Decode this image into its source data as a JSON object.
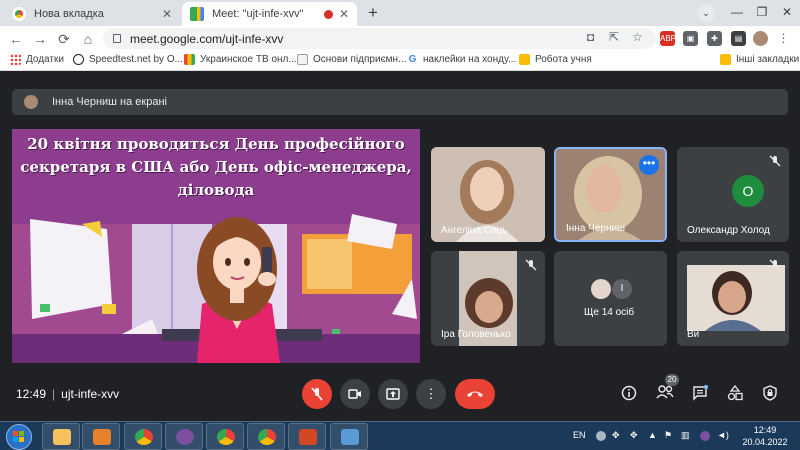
{
  "browser": {
    "tabs": [
      {
        "title": "Нова вкладка",
        "icon": "chrome-icon"
      },
      {
        "title": "Meet: \"ujt-infe-xvv\"",
        "icon": "meet-icon",
        "recording": true
      }
    ],
    "url": "meet.google.com/ujt-infe-xvv",
    "extension_labels": {
      "abp": "ABP"
    },
    "bookmarks": [
      {
        "label": "Додатки",
        "icon": "apps-grid-icon"
      },
      {
        "label": "Speedtest.net by O...",
        "icon": "speedtest-icon"
      },
      {
        "label": "Украинское ТВ онл...",
        "icon": "tv-icon"
      },
      {
        "label": "Основи підприємн...",
        "icon": "doc-icon"
      },
      {
        "label": "наклейки на хонду...",
        "icon": "google-icon"
      },
      {
        "label": "Робота учня",
        "icon": "classroom-icon"
      }
    ],
    "other_bookmarks": "Інші закладки"
  },
  "meet": {
    "presenting_text": "Інна Черниш на екрані",
    "slide_title": "20 квітня проводиться День професійного секретаря в США або День офіс-менеджера, діловода",
    "participants": [
      {
        "name": "Ангеліна Соць"
      },
      {
        "name": "Інна Черниш"
      },
      {
        "name": "Олександр Холод",
        "avatar_letter": "О"
      },
      {
        "name": "Іра Головенько"
      },
      {
        "name": "Ще 14 осіб",
        "avatar_letter": "І"
      },
      {
        "name": "Ви"
      }
    ],
    "time": "12:49",
    "meeting_code": "ujt-infe-xvv",
    "participant_count": "20"
  },
  "taskbar": {
    "language": "EN",
    "time": "12:49",
    "date": "20.04.2022"
  },
  "colors": {
    "meet_bg": "#202124",
    "tile_bg": "#3c4043",
    "hangup_red": "#ea4335",
    "accent_blue": "#1a73e8",
    "slide_purple": "#8c3d8d"
  }
}
